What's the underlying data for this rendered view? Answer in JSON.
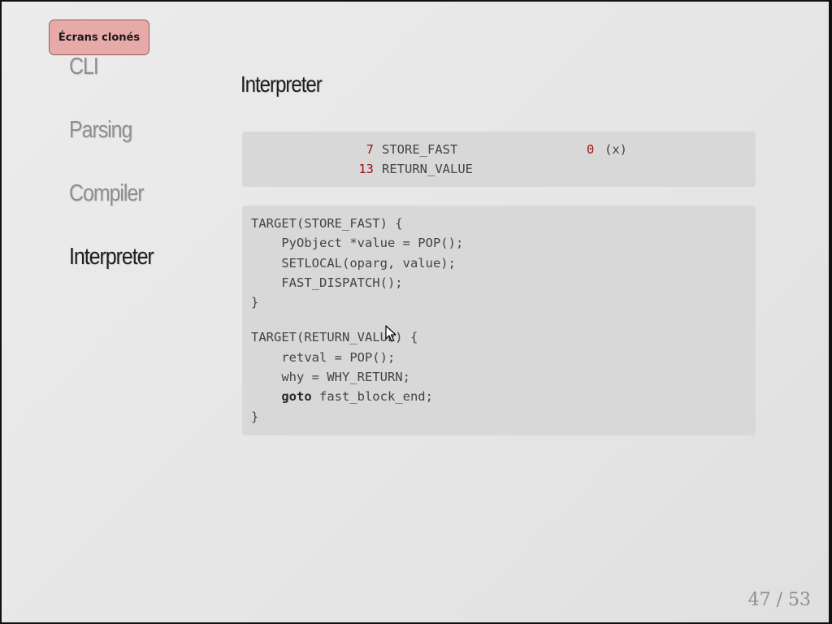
{
  "badge": {
    "label": "Écrans clonés"
  },
  "nav": {
    "items": [
      {
        "label": "CLI",
        "active": false
      },
      {
        "label": "Parsing",
        "active": false
      },
      {
        "label": "Compiler",
        "active": false
      },
      {
        "label": "Interpreter",
        "active": true
      }
    ]
  },
  "slide": {
    "title": "Interpreter",
    "bytecode": [
      {
        "offset": "7",
        "opname": "STORE_FAST",
        "arg": "0",
        "argrepr": "(x)"
      },
      {
        "offset": "13",
        "opname": "RETURN_VALUE",
        "arg": "",
        "argrepr": ""
      }
    ],
    "source_blocks": [
      [
        "TARGET(STORE_FAST) {",
        "    PyObject *value = POP();",
        "    SETLOCAL(oparg, value);",
        "    FAST_DISPATCH();",
        "}"
      ],
      [
        "TARGET(RETURN_VALUE) {",
        "    retval = POP();",
        "    why = WHY_RETURN;",
        "    goto fast_block_end;",
        "}"
      ]
    ],
    "keywords": [
      "goto"
    ]
  },
  "pager": {
    "current": "47",
    "total": "53",
    "text": "47 / 53"
  },
  "colors": {
    "background": "#e6e6e6",
    "code_background": "#d8d8d8",
    "number_red": "#a01010",
    "badge_fill": "#e8a9a9",
    "nav_inactive": "#8e8e8e",
    "nav_active": "#1d1d1d"
  },
  "icons": {
    "cursor": "mouse-pointer-icon"
  }
}
